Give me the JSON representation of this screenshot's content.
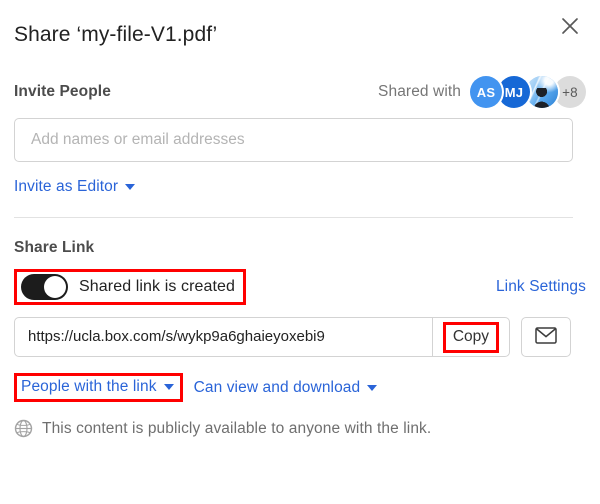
{
  "dialog": {
    "title": "Share ‘my-file-V1.pdf’",
    "close_icon": "close-icon"
  },
  "invite": {
    "label": "Invite People",
    "shared_with_label": "Shared with",
    "avatars": [
      {
        "initials": "AS",
        "type": "initials",
        "color": "#4294f0"
      },
      {
        "initials": "MJ",
        "type": "initials",
        "color": "#1668d6"
      },
      {
        "initials": "",
        "type": "photo",
        "color": "#7fb6e8"
      },
      {
        "initials": "+8",
        "type": "overflow",
        "color": "#dcdcdc"
      }
    ],
    "input_value": "",
    "input_placeholder": "Add names or email addresses",
    "role_link": "Invite as Editor",
    "role_caret_icon": "chevron-down-icon"
  },
  "share_link": {
    "label": "Share Link",
    "toggle_state": "on",
    "toggle_text": "Shared link is created",
    "link_settings": "Link Settings",
    "url_value": "https://ucla.box.com/s/wykp9a6ghaieyoxebi9",
    "copy_label": "Copy",
    "email_icon": "envelope-icon",
    "audience_label": "People with the link",
    "audience_caret_icon": "chevron-down-icon",
    "permission_label": "Can view and download",
    "permission_caret_icon": "chevron-down-icon",
    "notice_icon": "globe-icon",
    "notice_text": "This content is publicly available to anyone with the link."
  },
  "colors": {
    "link_blue": "#2a64d8",
    "annotation_red": "#ff0000",
    "toggle_on": "#1c1c1c",
    "border_gray": "#d3d3d3",
    "muted_text": "#767676"
  }
}
